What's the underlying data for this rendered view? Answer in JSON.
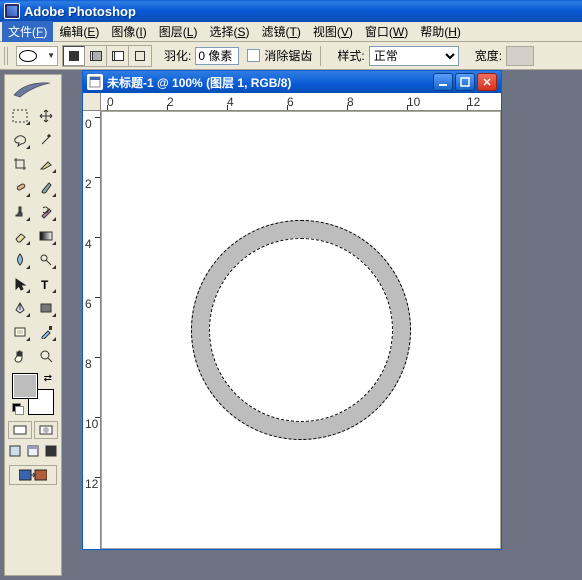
{
  "app": {
    "title": "Adobe Photoshop"
  },
  "menu": {
    "file": {
      "label": "文件",
      "accel": "F"
    },
    "edit": {
      "label": "编辑",
      "accel": "E"
    },
    "image": {
      "label": "图像",
      "accel": "I"
    },
    "layer": {
      "label": "图层",
      "accel": "L"
    },
    "select": {
      "label": "选择",
      "accel": "S"
    },
    "filter": {
      "label": "滤镜",
      "accel": "T"
    },
    "view": {
      "label": "视图",
      "accel": "V"
    },
    "window": {
      "label": "窗口",
      "accel": "W"
    },
    "help": {
      "label": "帮助",
      "accel": "H"
    }
  },
  "options": {
    "feather_label": "羽化:",
    "feather_value": "0 像素",
    "antialias_label": "消除锯齿",
    "style_label": "样式:",
    "style_value": "正常",
    "width_label": "宽度:"
  },
  "doc": {
    "title": "未标题-1 @ 100% (图层 1, RGB/8)",
    "ruler_h": [
      "0",
      "2",
      "4",
      "6",
      "8",
      "10",
      "12"
    ],
    "ruler_v": [
      "0",
      "2",
      "4",
      "6",
      "8",
      "10",
      "12"
    ]
  },
  "colors": {
    "foreground": "#bdbdbd",
    "background": "#ffffff"
  }
}
